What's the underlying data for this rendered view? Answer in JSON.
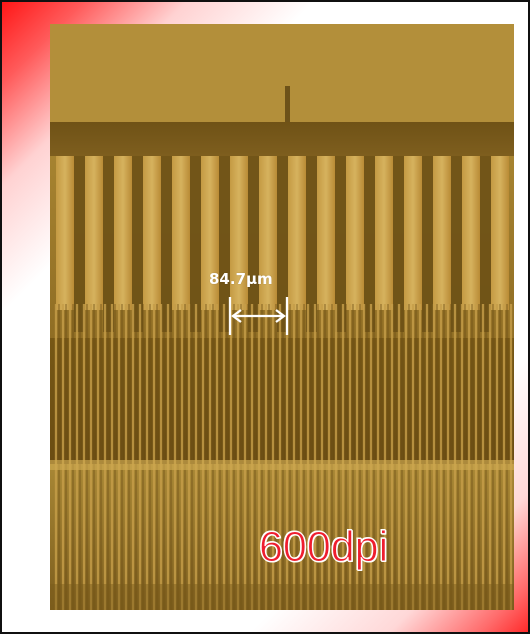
{
  "image": {
    "subject": "microscope-photo-of-fine-comb-pattern",
    "measurement_label": "84.7μm",
    "resolution_label": "600dpi",
    "colors": {
      "frame_accent": "#ff1717",
      "resolution_text": "#ef1d2f",
      "measurement_text": "#ffffff",
      "image_base": "#8e6f24",
      "line_gold": "#c49a43",
      "line_dark": "#7a561c"
    }
  }
}
